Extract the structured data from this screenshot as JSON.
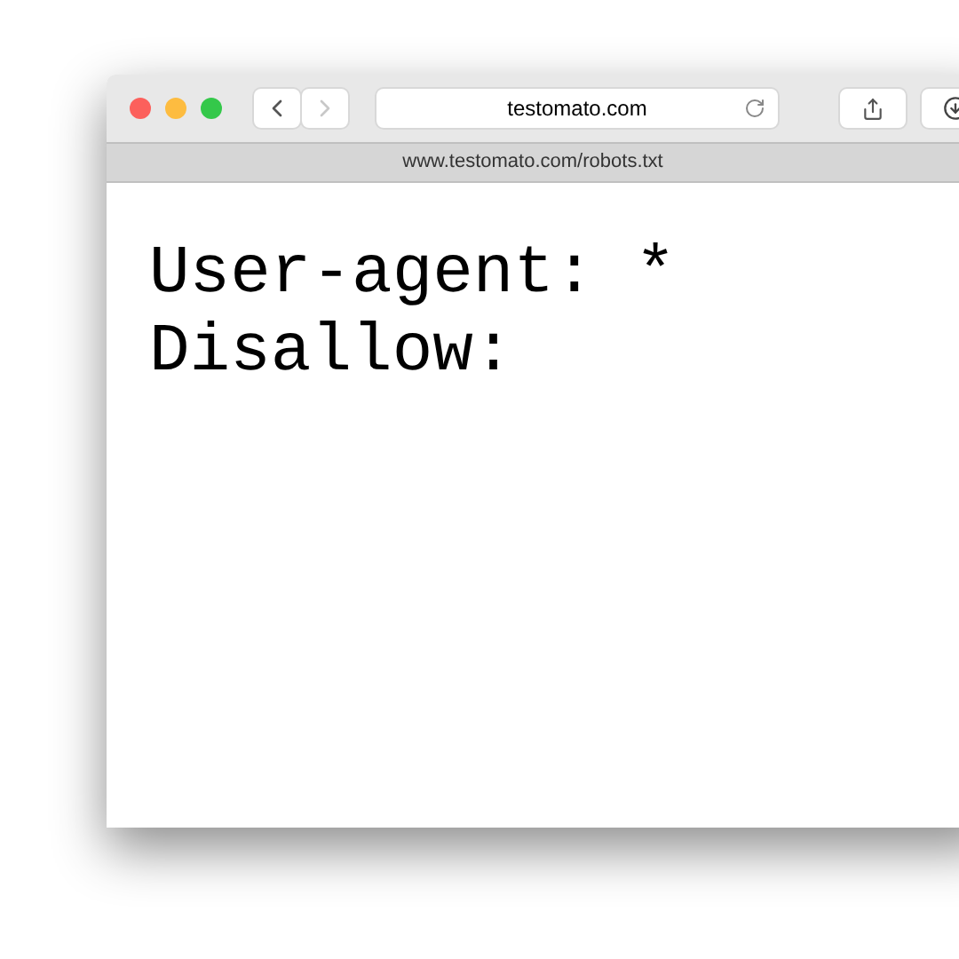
{
  "toolbar": {
    "back": {
      "disabled": false
    },
    "forward": {
      "disabled": true
    },
    "address": "testomato.com"
  },
  "tab": {
    "title": "www.testomato.com/robots.txt"
  },
  "content": {
    "lines": [
      "User-agent: *",
      "Disallow:"
    ]
  }
}
